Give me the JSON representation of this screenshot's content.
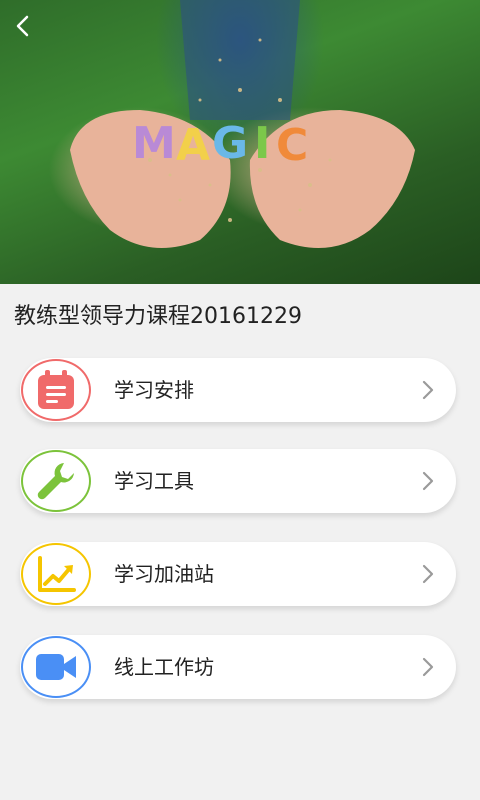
{
  "hero": {
    "back_icon": "chevron-left-icon",
    "image_caption": "MAGIC",
    "image_subject": "child hands holding glitter"
  },
  "course": {
    "title": "教练型领导力课程20161229"
  },
  "menu": [
    {
      "label": "学习安排",
      "icon": "calendar-icon",
      "color": "#f06a6a"
    },
    {
      "label": "学习工具",
      "icon": "wrench-icon",
      "color": "#7cc33b"
    },
    {
      "label": "学习加油站",
      "icon": "chart-up-icon",
      "color": "#f5c500"
    },
    {
      "label": "线上工作坊",
      "icon": "video-camera-icon",
      "color": "#4a8ff5"
    }
  ],
  "colors": {
    "background": "#f1f1f1",
    "card": "#ffffff",
    "chevron": "#9a9a9a"
  }
}
